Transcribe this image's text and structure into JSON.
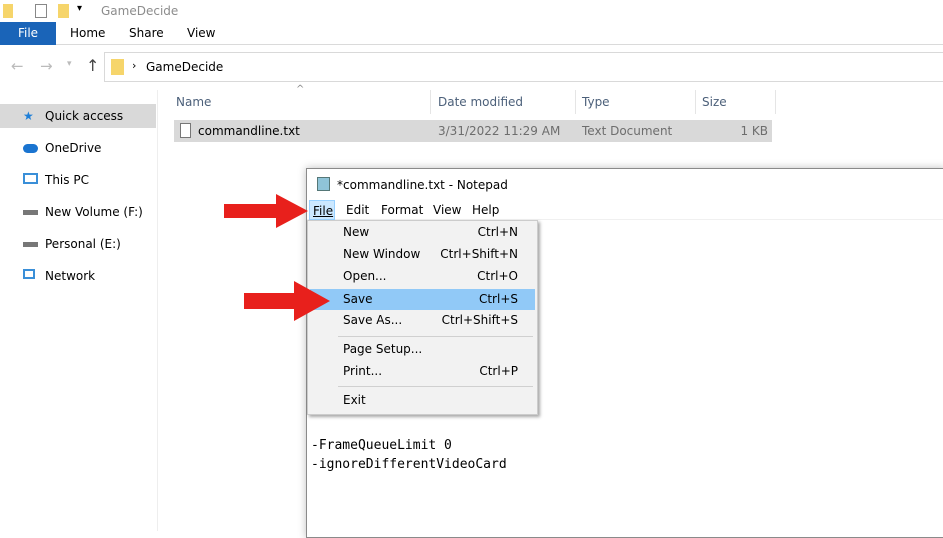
{
  "explorer": {
    "title": "GameDecide",
    "ribbon_tabs": [
      "File",
      "Home",
      "Share",
      "View"
    ],
    "address": "GameDecide",
    "sidebar": [
      {
        "label": "Quick access",
        "icon": "star-icon"
      },
      {
        "label": "OneDrive",
        "icon": "cloud-icon"
      },
      {
        "label": "This PC",
        "icon": "computer-icon"
      },
      {
        "label": "New Volume (F:)",
        "icon": "drive-icon"
      },
      {
        "label": "Personal (E:)",
        "icon": "drive-icon"
      },
      {
        "label": "Network",
        "icon": "network-icon"
      }
    ],
    "columns": [
      "Name",
      "Date modified",
      "Type",
      "Size"
    ],
    "files": [
      {
        "name": "commandline.txt",
        "date": "3/31/2022 11:29 AM",
        "type": "Text Document",
        "size": "1 KB"
      }
    ]
  },
  "notepad": {
    "title": "*commandline.txt - Notepad",
    "menus": [
      "File",
      "Edit",
      "Format",
      "View",
      "Help"
    ],
    "file_menu": [
      {
        "label": "New",
        "shortcut": "Ctrl+N"
      },
      {
        "label": "New Window",
        "shortcut": "Ctrl+Shift+N"
      },
      {
        "label": "Open...",
        "shortcut": "Ctrl+O"
      },
      {
        "label": "Save",
        "shortcut": "Ctrl+S"
      },
      {
        "label": "Save As...",
        "shortcut": "Ctrl+Shift+S"
      },
      {
        "label": "Page Setup...",
        "shortcut": ""
      },
      {
        "label": "Print...",
        "shortcut": "Ctrl+P"
      },
      {
        "label": "Exit",
        "shortcut": ""
      }
    ],
    "content_lines": [
      "-FrameQueueLimit 0",
      "-ignoreDifferentVideoCard"
    ]
  },
  "colors": {
    "accent": "#1a64b8",
    "menu_highlight": "#91c9f7",
    "arrow": "#e8201c"
  }
}
